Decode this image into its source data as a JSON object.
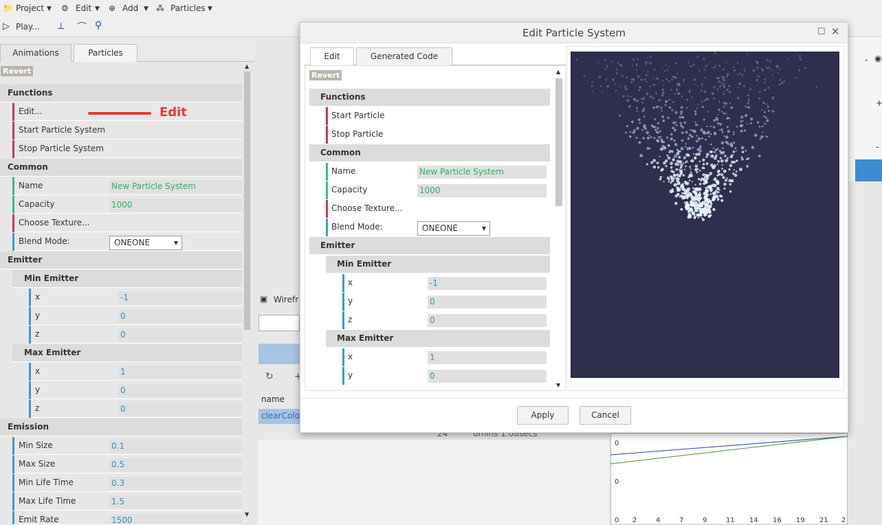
{
  "menu": {
    "project": "Project",
    "edit": "Edit",
    "add": "Add",
    "particles": "Particles",
    "play": "Play..."
  },
  "left_tabs": {
    "animations": "Animations",
    "particles": "Particles"
  },
  "left": {
    "revert": "Revert",
    "functions": "Functions",
    "edit": "Edit...",
    "start": "Start Particle System",
    "stop": "Stop Particle System",
    "common": "Common",
    "name_label": "Name",
    "name_val": "New Particle System",
    "cap_label": "Capacity",
    "cap_val": "1000",
    "texture": "Choose Texture...",
    "blend_label": "Blend Mode:",
    "blend_val": "ONEONE",
    "emitter": "Emitter",
    "min_emitter": "Min Emitter",
    "max_emitter": "Max Emitter",
    "x": "x",
    "y": "y",
    "z": "z",
    "min_x": "-1",
    "min_y": "0",
    "min_z": "0",
    "max_x": "1",
    "max_y": "0",
    "max_z": "0",
    "emission": "Emission",
    "min_size": "Min Size",
    "min_size_v": "0.1",
    "max_size": "Max Size",
    "max_size_v": "0.5",
    "min_life": "Min Life Time",
    "min_life_v": "0.3",
    "max_life": "Max Life Time",
    "max_life_v": "1.5",
    "emit_rate": "Emit Rate",
    "emit_rate_v": "1500"
  },
  "annotation": "Edit",
  "background": {
    "wireframe": "Wirefr",
    "name_header": "name",
    "clear": "clearColor",
    "row_num": "24",
    "row_time": "0mins 1.08secs",
    "graph_ticks": [
      "0",
      "2",
      "4",
      "7",
      "9",
      "11",
      "14",
      "16",
      "19",
      "21",
      "2"
    ],
    "graph_y0": "0",
    "graph_y1": "0",
    "minus": "-",
    "plus": "+"
  },
  "dialog": {
    "title": "Edit Particle System",
    "tab_edit": "Edit",
    "tab_code": "Generated Code",
    "revert": "Revert",
    "functions": "Functions",
    "start": "Start Particle",
    "stop": "Stop Particle",
    "common": "Common",
    "name_label": "Name",
    "name_val": "New Particle System",
    "cap_label": "Capacity",
    "cap_val": "1000",
    "texture": "Choose Texture...",
    "blend_label": "Blend Mode:",
    "blend_val": "ONEONE",
    "emitter": "Emitter",
    "min_emitter": "Min Emitter",
    "max_emitter": "Max Emitter",
    "x": "x",
    "y": "y",
    "z": "z",
    "min_x": "-1",
    "min_y": "0",
    "min_z": "0",
    "max_x": "1",
    "max_y": "0",
    "apply": "Apply",
    "cancel": "Cancel"
  },
  "colors": {
    "preview_bg": "#2f2e4c",
    "green_bar": "#33c07a",
    "pink_bar": "#d0335e",
    "blue_bar": "#3a9ad0"
  }
}
